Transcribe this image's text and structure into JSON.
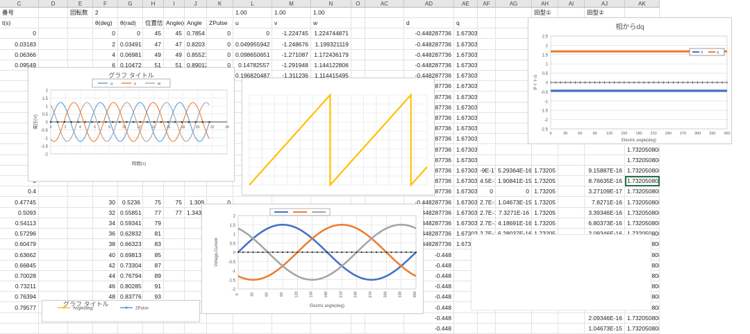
{
  "columns": [
    {
      "label": "C"
    },
    {
      "label": "D"
    },
    {
      "label": "E"
    },
    {
      "label": "F"
    },
    {
      "label": "G"
    },
    {
      "label": "H"
    },
    {
      "label": "I"
    },
    {
      "label": "J"
    },
    {
      "label": "K"
    },
    {
      "label": "L"
    },
    {
      "label": "M"
    },
    {
      "label": "N"
    },
    {
      "label": "O"
    },
    {
      "label": "AC"
    },
    {
      "label": "AD"
    },
    {
      "label": "AE"
    },
    {
      "label": "AF"
    },
    {
      "label": "AG"
    },
    {
      "label": "AH"
    },
    {
      "label": "AI"
    },
    {
      "label": "AJ"
    },
    {
      "label": "AK"
    }
  ],
  "header_rows": {
    "row1": [
      "番号",
      "",
      "回転数",
      "2",
      "",
      "",
      "",
      "",
      "",
      "1.00",
      "1.00",
      "1.00",
      "",
      "",
      "",
      "",
      "",
      "",
      "田​型①",
      "",
      "田型②",
      ""
    ],
    "row2": [
      "t(s)",
      "",
      "",
      "θ(deg)",
      "θ(rad)",
      "位置信号θ",
      "Angle(deg)",
      "Angle",
      "ZPulse",
      "u",
      "v",
      "w",
      "",
      "",
      "d",
      "q",
      "",
      "",
      "",
      "",
      "",
      ""
    ]
  },
  "rows": [
    [
      "0",
      "",
      "",
      "0",
      "0",
      "45",
      "45",
      "0.7854",
      "0",
      "0",
      "-1.224745",
      "1.224744871",
      "",
      "",
      "-0.448287736",
      "1.67303",
      "",
      "",
      "",
      "",
      "",
      "1.732050808"
    ],
    [
      "0.03183",
      "",
      "",
      "2",
      "0.03491",
      "47",
      "47",
      "0.8203",
      "0",
      "0.049955942",
      "-1.248676",
      "1.199321119",
      "",
      "",
      "-0.448287736",
      "1.67303",
      "",
      "",
      "",
      "",
      "",
      "1.732050808"
    ],
    [
      "0.06366",
      "",
      "",
      "4",
      "0.06981",
      "49",
      "49",
      "0.85521",
      "0",
      "0.098650651",
      "-1.271087",
      "1.172436179",
      "",
      "",
      "-0.448287736",
      "1.67303",
      "",
      "",
      "",
      "",
      "",
      "1.732050808"
    ],
    [
      "0.09549",
      "",
      "",
      "6",
      "0.10472",
      "51",
      "51",
      "0.89012",
      "0",
      "0.14782557",
      "-1.291948",
      "1.144122806",
      "",
      "",
      "-0.448287736",
      "1.67303",
      "",
      "",
      "",
      "",
      "",
      "1.732050808"
    ],
    [
      "0.1",
      "",
      "",
      "",
      "",
      "",
      "",
      "",
      "0",
      "0.196820487",
      "-1.311236",
      "1.114415495",
      "",
      "",
      "-0.448287736",
      "1.67303",
      "",
      "",
      "",
      "",
      "",
      "1.732050808"
    ],
    [
      "0.1",
      "",
      "",
      "",
      "",
      "",
      "",
      "",
      "",
      "",
      "",
      "",
      "",
      "",
      "-0.448287736",
      "1.67303",
      "",
      "",
      "",
      "",
      "",
      "1.732050808"
    ],
    [
      "0.1",
      "",
      "",
      "",
      "",
      "",
      "",
      "",
      "",
      "",
      "",
      "",
      "",
      "",
      "-0.448287736",
      "1.67303",
      "",
      "",
      "",
      "",
      "",
      "1.732050808"
    ],
    [
      "0.2",
      "",
      "",
      "",
      "",
      "",
      "",
      "",
      "",
      "",
      "",
      "",
      "",
      "",
      "-0.448287736",
      "1.67303",
      "",
      "",
      "",
      "",
      "",
      "1.732050808"
    ],
    [
      "0.2",
      "",
      "",
      "",
      "",
      "",
      "",
      "",
      "",
      "",
      "",
      "",
      "",
      "",
      "-0.448287736",
      "1.67303",
      "",
      "",
      "",
      "",
      "",
      "1.732050808"
    ],
    [
      "0.2",
      "",
      "",
      "",
      "",
      "",
      "",
      "",
      "",
      "",
      "",
      "",
      "",
      "",
      "-0.448287736",
      "1.67303",
      "",
      "",
      "",
      "",
      "",
      "1.732050808"
    ],
    [
      "0.3",
      "",
      "",
      "",
      "",
      "",
      "",
      "",
      "",
      "",
      "",
      "",
      "",
      "",
      "-0.448287736",
      "1.67303",
      "",
      "",
      "",
      "",
      "",
      "1.732050808"
    ],
    [
      "0.3",
      "",
      "",
      "",
      "",
      "",
      "",
      "",
      "",
      "",
      "",
      "",
      "",
      "",
      "-0.448287736",
      "1.67303",
      "",
      "",
      "",
      "",
      "",
      "1.732050808"
    ],
    [
      "0.3",
      "",
      "",
      "",
      "",
      "",
      "",
      "",
      "",
      "",
      "",
      "",
      "",
      "",
      "-0.448287736",
      "1.67303",
      "",
      "",
      "",
      "",
      "",
      "1.732050808"
    ],
    [
      "0.4",
      "",
      "",
      "",
      "",
      "",
      "",
      "",
      "",
      "",
      "",
      "",
      "",
      "",
      "-0.448287736",
      "1.67303",
      "-9E-17",
      "5.29364E-16",
      "1.73205",
      "",
      "9.15887E-16",
      "1.732050808"
    ],
    [
      "0",
      "",
      "",
      "",
      "",
      "",
      "",
      "",
      "",
      "",
      "",
      "",
      "",
      "",
      "-0.448287736",
      "1.67303",
      "4.5E-16",
      "1.90841E-15",
      "1.73205",
      "",
      "8.76635E-16",
      "1.732050808"
    ],
    [
      "0.4",
      "",
      "",
      "",
      "",
      "",
      "",
      "",
      "",
      "",
      "",
      "",
      "",
      "",
      "-0.448287736",
      "1.67303",
      "0",
      "0",
      "1.73205",
      "",
      "3.27109E-17",
      "1.732050808"
    ],
    [
      "0.47745",
      "",
      "",
      "30",
      "0.5236",
      "75",
      "75",
      "1.309",
      "0",
      "",
      "",
      "",
      "",
      "",
      "-0.448287736",
      "1.67303",
      "2.7E-16",
      "1.04673E-15",
      "1.73205",
      "",
      "7.8271E-16",
      "1.732050808"
    ],
    [
      "0.5093",
      "",
      "",
      "32",
      "0.55851",
      "77",
      "77",
      "1.3439",
      "0",
      "0.74941907",
      "-1.419952",
      "0.669933091",
      "",
      "",
      "-0.448287736",
      "1.67303",
      "2.7E-16",
      "7.3271E-16",
      "1.73205",
      "",
      "3.39346E-16",
      "1.732050808"
    ],
    [
      "0.54113",
      "",
      "",
      "34",
      "0.59341",
      "79",
      "",
      "",
      "",
      "",
      "",
      "",
      "",
      "",
      "-0.448287736",
      "1.67303",
      "2.7E-16",
      "4.18691E-16",
      "1.73205",
      "",
      "6.80373E-16",
      "1.732050808"
    ],
    [
      "0.57296",
      "",
      "",
      "36",
      "0.62832",
      "81",
      "",
      "",
      "",
      "",
      "",
      "",
      "",
      "",
      "-0.448287736",
      "1.67303",
      "2.7E-16",
      "6.28037E-16",
      "1.73205",
      "",
      "2.09346E-16",
      "1.732050808"
    ],
    [
      "0.60479",
      "",
      "",
      "38",
      "0.66323",
      "83",
      "",
      "",
      "",
      "",
      "",
      "",
      "",
      "",
      "-0.448287736",
      "1.67303",
      "3.6E-16",
      "1.1514E-15",
      "1.73205",
      "",
      "-2.61682E-17",
      "1.732050808"
    ],
    [
      "0.63662",
      "",
      "",
      "40",
      "0.69813",
      "85",
      "",
      "",
      "",
      "",
      "",
      "",
      "",
      "",
      "-0.448",
      "",
      "",
      "",
      "",
      "",
      "3.92523E-16",
      "1.732050808"
    ],
    [
      "0.66845",
      "",
      "",
      "42",
      "0.73304",
      "87",
      "",
      "",
      "",
      "",
      "",
      "",
      "",
      "",
      "-0.448",
      "",
      "",
      "",
      "",
      "",
      "2.7895E-16",
      "1.732050808"
    ],
    [
      "0.70028",
      "",
      "",
      "44",
      "0.76794",
      "89",
      "",
      "",
      "",
      "",
      "",
      "",
      "",
      "",
      "-0.448",
      "",
      "",
      "",
      "",
      "",
      "8.89719E-16",
      "1.732050808"
    ],
    [
      "0.73211",
      "",
      "",
      "46",
      "0.80285",
      "91",
      "",
      "",
      "",
      "",
      "",
      "",
      "",
      "",
      "-0.448",
      "",
      "",
      "",
      "",
      "",
      "9.42055E-16",
      "1.732050808"
    ],
    [
      "0.76394",
      "",
      "",
      "48",
      "0.83776",
      "93",
      "",
      "",
      "",
      "",
      "",
      "",
      "",
      "",
      "-0.448",
      "",
      "",
      "",
      "",
      "",
      "1.04673E-15",
      "1.732050808"
    ],
    [
      "0.79577",
      "",
      "",
      "50",
      "0.87266",
      "95",
      "",
      "",
      "",
      "",
      "",
      "",
      "",
      "",
      "-0.448",
      "",
      "",
      "",
      "",
      "",
      "9.94392E-16",
      "1.732050808"
    ],
    [
      "",
      "",
      "",
      "",
      "",
      "",
      "",
      "",
      "",
      "",
      "",
      "",
      "",
      "",
      "-0.448",
      "",
      "",
      "",
      "",
      "",
      "2.09346E-16",
      "1.732050808"
    ],
    [
      "",
      "",
      "",
      "",
      "",
      "",
      "",
      "",
      "",
      "",
      "",
      "",
      "",
      "",
      "-0.448",
      "",
      "",
      "",
      "",
      "",
      "1.04673E-15",
      "1.732050808"
    ]
  ],
  "charts": {
    "chart1": {
      "title": "グラフ タイトル",
      "ylabel": "電圧(V)",
      "xlabel": "時間(s)",
      "legend": [
        "u",
        "v",
        "w"
      ],
      "colors": [
        "#5b9bd5",
        "#ed7d31",
        "#a5a5a5"
      ],
      "yticks": [
        "2",
        "1.5",
        "1",
        "0.5",
        "0",
        "-0.5",
        "-1",
        "-1.5",
        "-2"
      ]
    },
    "chart2": {
      "color": "#ffc000"
    },
    "chart3": {
      "ylabel": "Voltage,Current",
      "xlabel": "Electric angle(deg)",
      "legend": [
        "",
        "",
        ""
      ],
      "colors": [
        "#4472c4",
        "#ed7d31",
        "#a5a5a5"
      ],
      "yticks": [
        "2",
        "1.5",
        "1",
        "0.5",
        "0",
        "-0.5",
        "-1",
        "-1.5",
        "-2"
      ],
      "xticks": [
        "0",
        "30",
        "60",
        "90",
        "120",
        "150",
        "180",
        "210",
        "240",
        "270",
        "300",
        "330",
        "360"
      ]
    },
    "chart4": {
      "title": "相からdq",
      "ylabel": "タイトル",
      "xlabel": "Electric angle(deg)",
      "legend": [
        "d",
        "q"
      ],
      "colors": [
        "#4472c4",
        "#ed7d31"
      ],
      "yticks": [
        "2.5",
        "2",
        "1.5",
        "1",
        "0.5",
        "0",
        "-0.5",
        "-1",
        "-1.5",
        "-2",
        "-2.5"
      ],
      "xticks": [
        "0",
        "30",
        "60",
        "90",
        "120",
        "150",
        "180",
        "210",
        "240",
        "270",
        "300",
        "330",
        "360"
      ]
    },
    "chart5": {
      "title": "グラフ タイトル",
      "legend": [
        "Angle(deg)",
        "ZPulse"
      ],
      "colors": [
        "#ffc000",
        "#5b9bd5"
      ]
    }
  },
  "chart_data": [
    {
      "type": "line",
      "title": "グラフ タイトル",
      "xlabel": "時間(s)",
      "ylabel": "電圧(V)",
      "ylim": [
        -2,
        2
      ],
      "series": [
        {
          "name": "u",
          "shape": "sine",
          "phase_deg": 0,
          "amp": 1.22
        },
        {
          "name": "v",
          "shape": "sine",
          "phase_deg": -120,
          "amp": 1.22
        },
        {
          "name": "w",
          "shape": "sine",
          "phase_deg": 120,
          "amp": 1.22
        }
      ],
      "cycles": 4
    },
    {
      "type": "line",
      "title": "",
      "series": [
        {
          "name": "Angle",
          "shape": "sawtooth"
        }
      ],
      "cycles": 2.2
    },
    {
      "type": "line",
      "title": "",
      "xlabel": "Electric angle(deg)",
      "ylabel": "Voltage,Current",
      "ylim": [
        -2,
        2
      ],
      "xlim": [
        0,
        360
      ],
      "series": [
        {
          "name": "",
          "shape": "sine",
          "phase_deg": 0,
          "amp": 1.5
        },
        {
          "name": "",
          "shape": "sine",
          "phase_deg": -120,
          "amp": 1.5
        },
        {
          "name": "",
          "shape": "sine",
          "phase_deg": 120,
          "amp": 1.5
        }
      ]
    },
    {
      "type": "line",
      "title": "相からdq",
      "xlabel": "Electric angle(deg)",
      "ylabel": "タイトル",
      "ylim": [
        -2.5,
        2.5
      ],
      "xlim": [
        0,
        360
      ],
      "series": [
        {
          "name": "d",
          "shape": "const",
          "value": -0.448
        },
        {
          "name": "q",
          "shape": "const",
          "value": 1.673
        }
      ]
    }
  ]
}
